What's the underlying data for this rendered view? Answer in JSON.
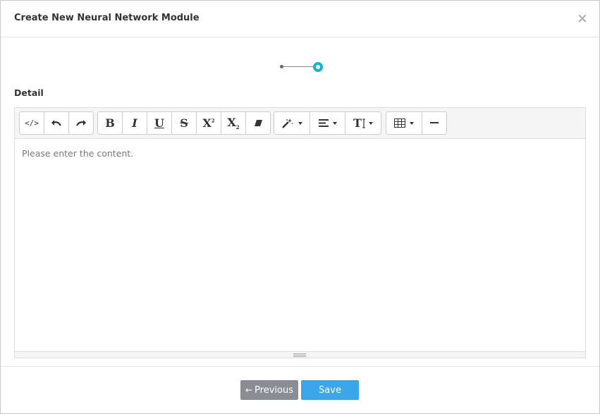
{
  "modal": {
    "title": "Create New Neural Network Module",
    "close_glyph": "×"
  },
  "stepper": {
    "steps": 2,
    "active_step": 2,
    "accent_color": "#17b5c8"
  },
  "field": {
    "label": "Detail"
  },
  "editor": {
    "placeholder": "Please enter the content.",
    "toolbar": [
      {
        "group": "code-history",
        "buttons": [
          "code-view-icon",
          "undo-icon",
          "redo-icon"
        ]
      },
      {
        "group": "font-style",
        "buttons": [
          "bold-icon",
          "italic-icon",
          "underline-icon",
          "strikethrough-icon",
          "superscript-icon",
          "subscript-icon",
          "eraser-icon"
        ]
      },
      {
        "group": "paragraph",
        "buttons": [
          "magic-style-icon",
          "align-icon",
          "font-size-icon"
        ]
      },
      {
        "group": "insert",
        "buttons": [
          "table-icon",
          "horizontal-rule-icon"
        ]
      }
    ],
    "labels": {
      "code": "</>",
      "bold": "B",
      "italic": "I",
      "underline": "U",
      "strike": "S",
      "sup": "X",
      "sub": "X",
      "fontsize": "T"
    }
  },
  "footer": {
    "previous_label": "Previous",
    "save_label": "Save",
    "previous_color": "#8a8e94",
    "save_color": "#3ba7ea"
  }
}
